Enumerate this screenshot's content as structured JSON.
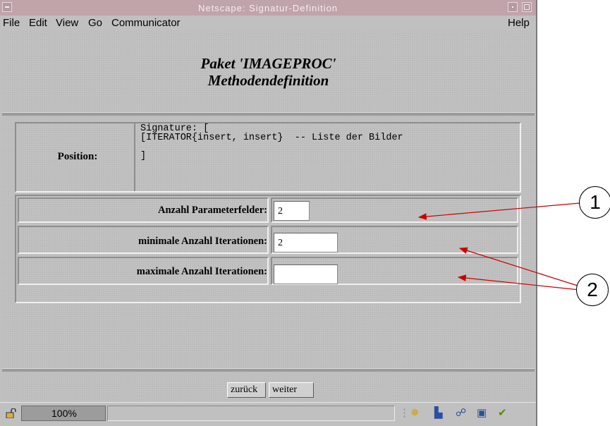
{
  "window": {
    "title": "Netscape: Signatur-Definition"
  },
  "menubar": {
    "file": "File",
    "edit": "Edit",
    "view": "View",
    "go": "Go",
    "communicator": "Communicator",
    "help": "Help"
  },
  "page": {
    "heading_line1": "Paket 'IMAGEPROC'",
    "heading_line2": "Methodendefinition"
  },
  "position": {
    "label": "Position:",
    "code_line1": "Signature: [",
    "code_line2": "[ITERATOR{insert, insert}  -- Liste der Bilder",
    "code_line3": "]"
  },
  "params": [
    {
      "label": "Anzahl Parameterfelder:",
      "value": "2"
    },
    {
      "label": "minimale Anzahl Iterationen:",
      "value": "2"
    },
    {
      "label": "maximale Anzahl Iterationen:",
      "value": ""
    }
  ],
  "buttons": {
    "back": "zurück",
    "next": "weiter"
  },
  "statusbar": {
    "progress": "100%"
  },
  "callouts": {
    "one": "1",
    "two": "2"
  },
  "colors": {
    "titlebar": "#c1a3aa",
    "arrow": "#cc0000"
  },
  "icons": [
    "lock-icon",
    "component-bar-icons"
  ]
}
